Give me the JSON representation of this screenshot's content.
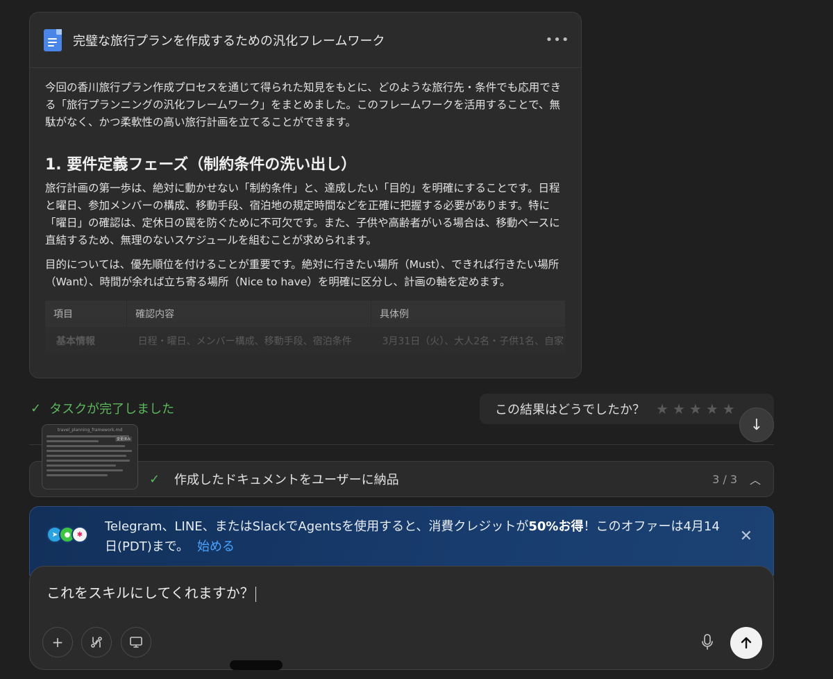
{
  "document": {
    "title": "完璧な旅行プランを作成するための汎化フレームワーク",
    "more_label": "•••",
    "intro": "今回の香川旅行プラン作成プロセスを通じて得られた知見をもとに、どのような旅行先・条件でも応用できる「旅行プランニングの汎化フレームワーク」をまとめました。このフレームワークを活用することで、無駄がなく、かつ柔軟性の高い旅行計画を立てることができます。",
    "section_heading": "1. 要件定義フェーズ（制約条件の洗い出し）",
    "para1": "旅行計画の第一歩は、絶対に動かせない「制約条件」と、達成したい「目的」を明確にすることです。日程と曜日、参加メンバーの構成、移動手段、宿泊地の規定時間などを正確に把握する必要があります。特に「曜日」の確認は、定休日の罠を防ぐために不可欠です。また、子供や高齢者がいる場合は、移動ペースに直結するため、無理のないスケジュールを組むことが求められます。",
    "para2": "目的については、優先順位を付けることが重要です。絶対に行きたい場所（Must）、できれば行きたい場所（Want）、時間が余れば立ち寄る場所（Nice to have）を明確に区分し、計画の軸を定めます。",
    "table": {
      "headers": [
        "項目",
        "確認内容",
        "具体例"
      ],
      "rows": [
        [
          "基本情報",
          "日程・曜日、メンバー構成、移動手段、宿泊条件",
          "3月31日（火）、大人2名・子供1名、自家"
        ]
      ]
    }
  },
  "status": {
    "task_done": "タスクが完了しました",
    "rating_question": "この結果はどうでしたか？",
    "stars": 5
  },
  "thumbnail": {
    "filename": "travel_planning_framework.md",
    "tag": "変更済み"
  },
  "step": {
    "label": "作成したドキュメントをユーザーに納品",
    "count": "3 / 3"
  },
  "promo": {
    "text_a": "Telegram、LINE、またはSlackでAgentsを使用すると、消費クレジットが",
    "text_bold": "50%お得",
    "text_b": "！このオファーは4月14日(PDT)まで。",
    "link": "始める"
  },
  "composer": {
    "value": "これをスキルにしてくれますか？"
  },
  "colors": {
    "accent_green": "#5cb85c",
    "link_blue": "#4aa3ff",
    "promo_bg": "#183c6e"
  }
}
